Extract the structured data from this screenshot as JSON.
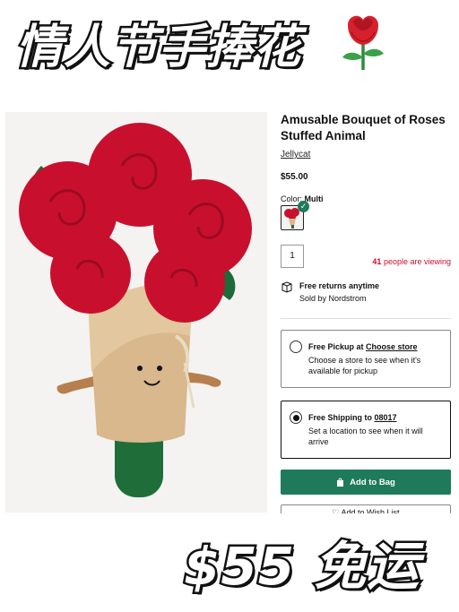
{
  "banner": {
    "title": "情人节手捧花"
  },
  "product": {
    "title": "Amusable Bouquet of Roses Stuffed Animal",
    "brand": "Jellycat",
    "price": "$55.00",
    "color_label": "Color:",
    "color_value": "Multi",
    "quantity": "1",
    "viewing_count": "41",
    "viewing_text": "people are viewing",
    "returns_title": "Free returns anytime",
    "sold_by": "Sold by Nordstrom"
  },
  "fulfillment": {
    "pickup": {
      "title": "Free Pickup at",
      "link": "Choose store",
      "desc": "Choose a store to see when it's available for pickup",
      "selected": false
    },
    "shipping": {
      "title": "Free Shipping to",
      "link": "08017",
      "desc": "Set a location to see when it will arrive",
      "selected": true
    }
  },
  "actions": {
    "add_to_bag": "Add to Bag",
    "wishlist": "Add to Wish List"
  },
  "promo": {
    "text": "$55 免运"
  },
  "colors": {
    "accent": "#1f7a5c",
    "alert": "#c8102e",
    "rose": "#c8102e"
  }
}
